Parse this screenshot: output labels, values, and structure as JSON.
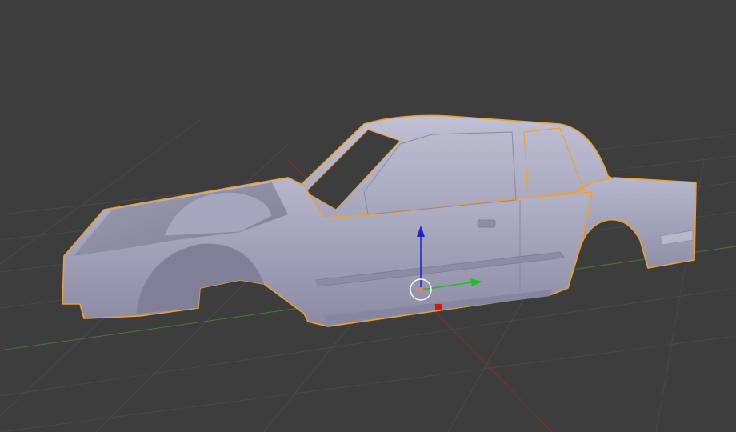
{
  "viewport": {
    "background": "#3d3d3d",
    "grid_color": "#4a4a4a",
    "x_axis_color": "#8f2b2b",
    "y_axis_color": "#3f7f2a"
  },
  "object": {
    "type": "car-body-shell",
    "selected": true,
    "selection_outline_color": "#f0a030",
    "body_color": "#a8a8c0"
  },
  "gizmo": {
    "mode": "translate",
    "x_color": "#dd1111",
    "y_color": "#22bb22",
    "z_color": "#2222cc",
    "origin_color": "#e8883a"
  }
}
